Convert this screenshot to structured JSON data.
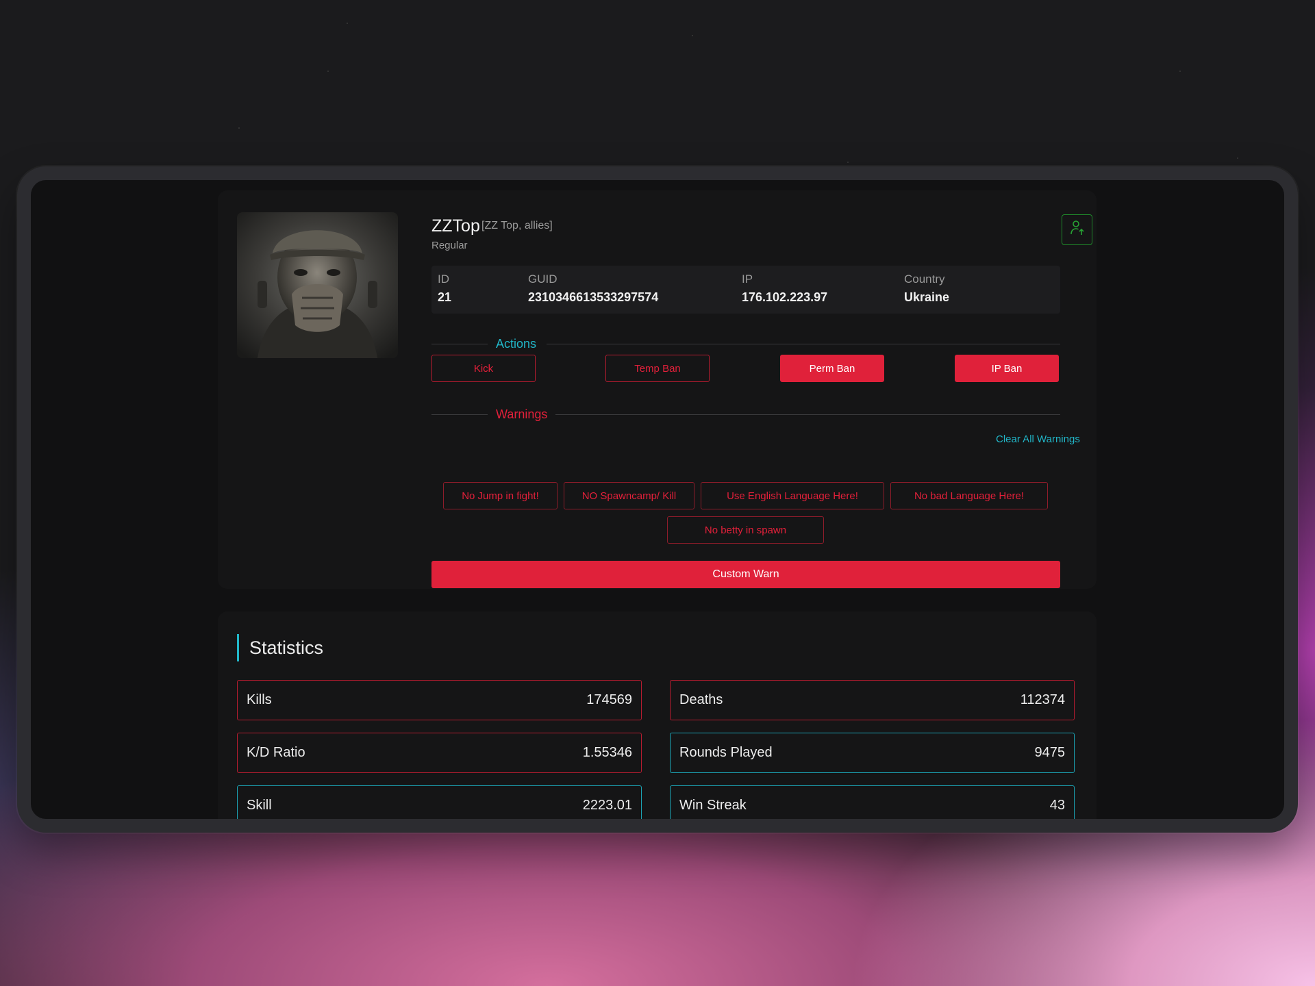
{
  "player": {
    "name": "ZZTop",
    "alias": "[ZZ Top, allies]",
    "role": "Regular"
  },
  "info": {
    "id_label": "ID",
    "id_value": "21",
    "guid_label": "GUID",
    "guid_value": "2310346613533297574",
    "ip_label": "IP",
    "ip_value": "176.102.223.97",
    "country_label": "Country",
    "country_value": "Ukraine"
  },
  "actions": {
    "section_label": "Actions",
    "kick": "Kick",
    "temp_ban": "Temp Ban",
    "perm_ban": "Perm Ban",
    "ip_ban": "IP Ban"
  },
  "warnings": {
    "section_label": "Warnings",
    "clear_all": "Clear All Warnings",
    "presets": [
      "No Jump in fight!",
      "NO Spawncamp/ Kill",
      "Use English Language Here!",
      "No bad Language Here!",
      "No betty in spawn"
    ],
    "custom_warn": "Custom Warn"
  },
  "statistics": {
    "title": "Statistics",
    "items": [
      {
        "label": "Kills",
        "value": "174569"
      },
      {
        "label": "Deaths",
        "value": "112374"
      },
      {
        "label": "K/D Ratio",
        "value": "1.55346"
      },
      {
        "label": "Rounds Played",
        "value": "9475"
      },
      {
        "label": "Skill",
        "value": "2223.01"
      },
      {
        "label": "Win Streak",
        "value": "43"
      }
    ]
  },
  "icons": {
    "header_button": "user-promote-icon"
  },
  "colors": {
    "accent_red": "#e0213a",
    "accent_cyan": "#21b6c8",
    "accent_green": "#1f8a2a"
  }
}
